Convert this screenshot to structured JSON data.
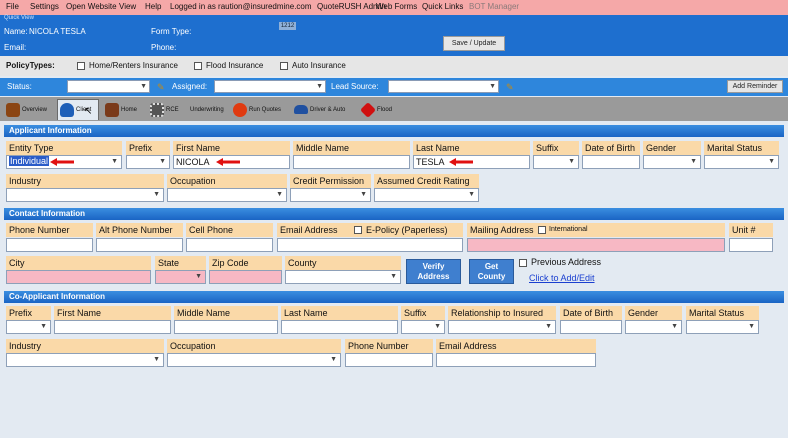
{
  "menu": [
    "File",
    "Settings",
    "Open Website",
    "View",
    "Help",
    "Logged in as raution@insuredmine.com",
    "QuoteRUSH Admin",
    "Web Forms",
    "Quick Links",
    "BOT Manager"
  ],
  "quick_view": {
    "title": "Quick View",
    "name_label": "Name:",
    "name_value": "NICOLA TESLA",
    "email_label": "Email:",
    "form_type_label": "Form Type:",
    "phone_label": "Phone:",
    "badge": "1212",
    "save_button": "Save / Update"
  },
  "policy_types": {
    "label": "PolicyTypes:",
    "options": [
      "Home/Renters Insurance",
      "Flood Insurance",
      "Auto Insurance"
    ]
  },
  "status_bar": {
    "status_label": "Status:",
    "assigned_label": "Assigned:",
    "lead_source_label": "Lead Source:",
    "add_reminder": "Add Reminder"
  },
  "tabs": [
    {
      "label": "Overview",
      "icon": "overview-icon",
      "color": "#8b4513"
    },
    {
      "label": "Client",
      "icon": "client-person-icon",
      "color": "#1e5fb8"
    },
    {
      "label": "Home",
      "icon": "home-icon",
      "color": "#7a3a1a"
    },
    {
      "label": "RCE",
      "icon": "rce-icon",
      "color": "#555555"
    },
    {
      "label": "Underwriting",
      "icon": "",
      "color": ""
    },
    {
      "label": "Run Quotes",
      "icon": "lightning-icon",
      "color": "#e03a10"
    },
    {
      "label": "Driver & Auto",
      "icon": "car-icon",
      "color": "#2050a0"
    },
    {
      "label": "Flood",
      "icon": "flood-warning-icon",
      "color": "#d01010"
    }
  ],
  "applicant": {
    "section_title": "Applicant Information",
    "labels": {
      "entity_type": "Entity Type",
      "prefix": "Prefix",
      "first_name": "First Name",
      "middle_name": "Middle Name",
      "last_name": "Last Name",
      "suffix": "Suffix",
      "dob": "Date of Birth",
      "gender": "Gender",
      "marital_status": "Marital Status",
      "industry": "Industry",
      "occupation": "Occupation",
      "credit_permission": "Credit Permission",
      "assumed_credit_rating": "Assumed Credit Rating"
    },
    "values": {
      "entity_type": "Individual",
      "first_name": "NICOLA",
      "last_name": "TESLA"
    }
  },
  "contact": {
    "section_title": "Contact Information",
    "labels": {
      "phone_number": "Phone Number",
      "alt_phone_number": "Alt Phone Number",
      "cell_phone": "Cell Phone",
      "email_address": "Email Address",
      "epolicy": "E-Policy (Paperless)",
      "mailing_address": "Mailing Address",
      "international": "International",
      "unit": "Unit #",
      "city": "City",
      "state": "State",
      "zip_code": "Zip Code",
      "county": "County",
      "previous_address": "Previous Address"
    },
    "verify_address": "Verify Address",
    "get_county": "Get County",
    "click_to_add": "Click to Add/Edit"
  },
  "co_applicant": {
    "section_title": "Co-Applicant Information",
    "labels": {
      "prefix": "Prefix",
      "first_name": "First Name",
      "middle_name": "Middle Name",
      "last_name": "Last Name",
      "suffix": "Suffix",
      "relationship": "Relationship to Insured",
      "dob": "Date of Birth",
      "gender": "Gender",
      "marital_status": "Marital Status",
      "industry": "Industry",
      "occupation": "Occupation",
      "phone_number": "Phone Number",
      "email_address": "Email Address"
    }
  }
}
